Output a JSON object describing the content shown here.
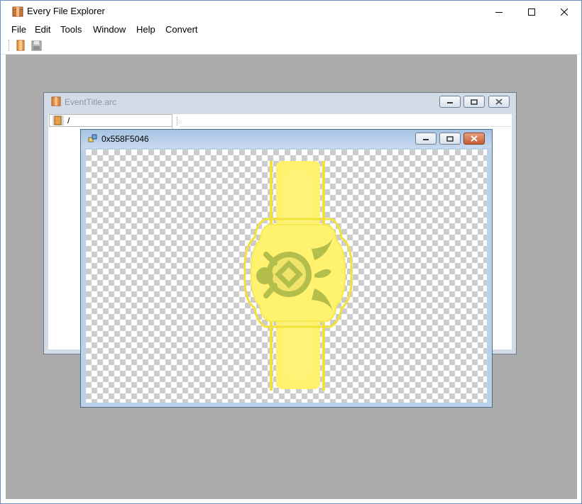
{
  "window": {
    "title": "Every File Explorer",
    "icon": "package-icon"
  },
  "menu": [
    "File",
    "Edit",
    "Tools",
    "Window",
    "Help",
    "Convert"
  ],
  "toolbar": {
    "buttons": [
      "open-folder-icon",
      "save-disk-icon"
    ]
  },
  "archive_window": {
    "title": "EventTitle.arc",
    "tree_root": "/"
  },
  "image_window": {
    "title": "0x558F5046",
    "image": {
      "description_colors": {
        "band": "#ffef6b",
        "outline": "#f2e13a",
        "emblem": "#b3bf4a"
      }
    }
  },
  "colors": {
    "mdi_background": "#ababab",
    "active_title": "#a6c3e4",
    "close_button": "#c75c34"
  }
}
